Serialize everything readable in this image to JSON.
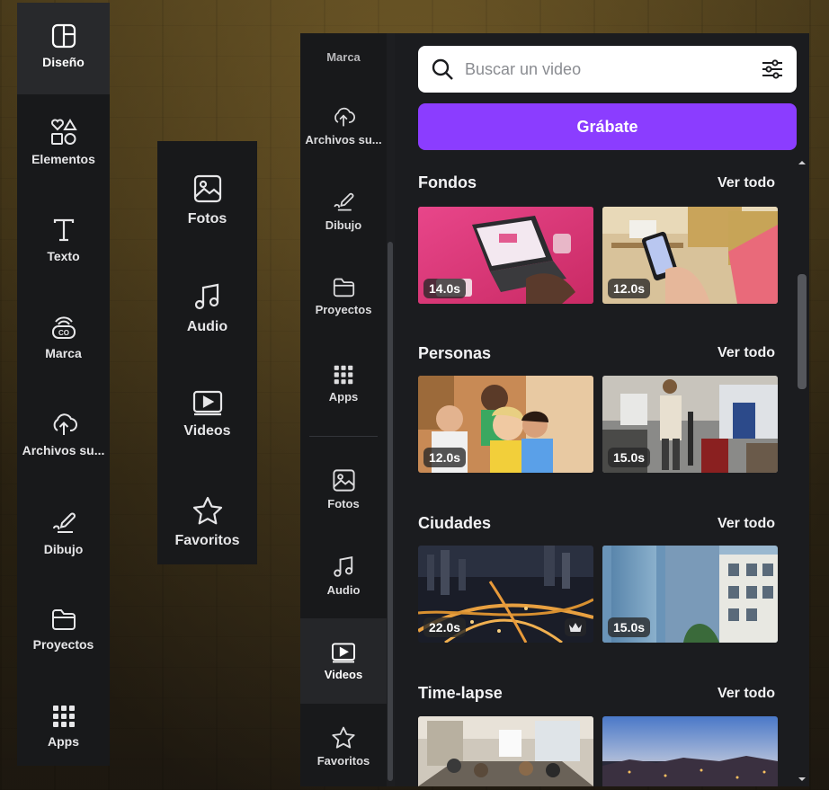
{
  "sidebar_main": {
    "items": [
      {
        "label": "Diseño",
        "icon": "layout-icon",
        "active": true
      },
      {
        "label": "Elementos",
        "icon": "shapes-icon"
      },
      {
        "label": "Texto",
        "icon": "text-icon"
      },
      {
        "label": "Marca",
        "icon": "brand-icon"
      },
      {
        "label": "Archivos su...",
        "icon": "cloud-upload-icon"
      },
      {
        "label": "Dibujo",
        "icon": "draw-icon"
      },
      {
        "label": "Proyectos",
        "icon": "folder-icon"
      },
      {
        "label": "Apps",
        "icon": "apps-grid-icon"
      }
    ]
  },
  "sidebar_media": {
    "items": [
      {
        "label": "Fotos",
        "icon": "image-icon"
      },
      {
        "label": "Audio",
        "icon": "music-note-icon"
      },
      {
        "label": "Videos",
        "icon": "video-icon"
      },
      {
        "label": "Favoritos",
        "icon": "star-icon"
      }
    ]
  },
  "panel": {
    "rail": [
      {
        "label": "Marca",
        "icon": "brand-icon"
      },
      {
        "label": "Archivos su...",
        "icon": "cloud-upload-icon"
      },
      {
        "label": "Dibujo",
        "icon": "draw-icon"
      },
      {
        "label": "Proyectos",
        "icon": "folder-icon"
      },
      {
        "label": "Apps",
        "icon": "apps-grid-icon"
      },
      {
        "label": "Fotos",
        "icon": "image-icon"
      },
      {
        "label": "Audio",
        "icon": "music-note-icon"
      },
      {
        "label": "Videos",
        "icon": "video-icon",
        "active": true
      },
      {
        "label": "Favoritos",
        "icon": "star-icon"
      }
    ],
    "search": {
      "placeholder": "Buscar un video"
    },
    "record_button": "Grábate",
    "sections": [
      {
        "title": "Fondos",
        "link": "Ver todo",
        "videos": [
          {
            "duration": "14.0s"
          },
          {
            "duration": "12.0s"
          }
        ]
      },
      {
        "title": "Personas",
        "link": "Ver todo",
        "videos": [
          {
            "duration": "12.0s"
          },
          {
            "duration": "15.0s"
          }
        ]
      },
      {
        "title": "Ciudades",
        "link": "Ver todo",
        "videos": [
          {
            "duration": "22.0s",
            "premium": true
          },
          {
            "duration": "15.0s"
          }
        ]
      },
      {
        "title": "Time-lapse",
        "link": "Ver todo",
        "videos": [
          {
            "duration": ""
          },
          {
            "duration": ""
          }
        ]
      }
    ]
  },
  "colors": {
    "accent": "#8b3dff",
    "panel_bg": "#18191b",
    "active_item_bg": "#28292c"
  }
}
